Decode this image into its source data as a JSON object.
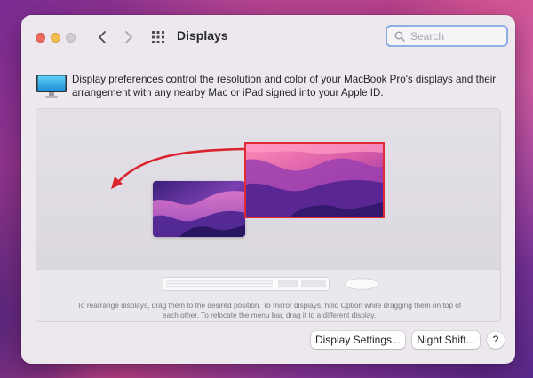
{
  "window": {
    "title": "Displays"
  },
  "search": {
    "placeholder": "Search",
    "value": ""
  },
  "info": {
    "text": "Display preferences control the resolution and color of your MacBook Pro's displays and their arrangement with any nearby Mac or iPad signed into your Apple ID."
  },
  "arrangement": {
    "hint": "To rearrange displays, drag them to the desired position. To mirror displays, hold Option while dragging them on top of each other. To relocate the menu bar, drag it to a different display."
  },
  "buttons": {
    "display_settings": "Display Settings...",
    "night_shift": "Night Shift...",
    "help": "?"
  },
  "colors": {
    "selection_highlight": "#e02a36",
    "arrow": "#d9242f",
    "search_focus_ring": "#8aaee6"
  },
  "icons": [
    "back-chevron-icon",
    "forward-chevron-icon",
    "grid-icon",
    "search-icon",
    "display-icon",
    "keyboard-icon",
    "mouse-icon",
    "arrow-icon"
  ]
}
